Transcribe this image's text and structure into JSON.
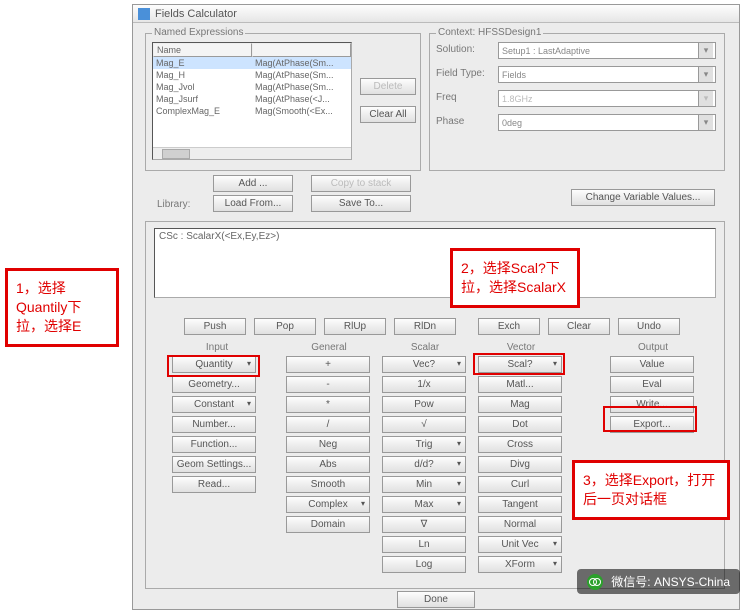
{
  "window": {
    "title": "Fields Calculator"
  },
  "named_expressions": {
    "label": "Named Expressions",
    "headers": [
      "Name",
      ""
    ],
    "rows": [
      {
        "name": "Mag_E",
        "expr": "Mag(AtPhase(Sm..."
      },
      {
        "name": "Mag_H",
        "expr": "Mag(AtPhase(Sm..."
      },
      {
        "name": "Mag_Jvol",
        "expr": "Mag(AtPhase(Sm..."
      },
      {
        "name": "Mag_Jsurf",
        "expr": "Mag(AtPhase(<J..."
      },
      {
        "name": "ComplexMag_E",
        "expr": "Mag(Smooth(<Ex..."
      }
    ],
    "buttons": {
      "delete": "Delete",
      "clear_all": "Clear All"
    }
  },
  "actions": {
    "add": "Add ...",
    "copy": "Copy to stack",
    "load": "Load From...",
    "save": "Save To...",
    "library_label": "Library:"
  },
  "context": {
    "label": "Context: HFSSDesign1",
    "solution_label": "Solution:",
    "solution_value": "Setup1 : LastAdaptive",
    "field_type_label": "Field Type:",
    "field_type_value": "Fields",
    "freq_label": "Freq",
    "freq_value": "1.8GHz",
    "phase_label": "Phase",
    "phase_value": "0deg",
    "change_vars": "Change Variable Values..."
  },
  "stack": {
    "top": "CSc : ScalarX(<Ex,Ey,Ez>)"
  },
  "stack_buttons": {
    "push": "Push",
    "pop": "Pop",
    "rlup": "RlUp",
    "rldn": "RlDn",
    "exch": "Exch",
    "clear": "Clear",
    "undo": "Undo"
  },
  "columns": {
    "input": "Input",
    "general": "General",
    "scalar": "Scalar",
    "vector": "Vector",
    "output": "Output"
  },
  "input": {
    "quantity": "Quantity",
    "geometry": "Geometry...",
    "constant": "Constant",
    "number": "Number...",
    "function": "Function...",
    "geom_settings": "Geom Settings...",
    "read": "Read..."
  },
  "general": {
    "plus": "+",
    "minus": "-",
    "mult": "*",
    "div": "/",
    "neg": "Neg",
    "abs": "Abs",
    "smooth": "Smooth",
    "complex": "Complex",
    "domain": "Domain"
  },
  "scalar": {
    "vec": "Vec?",
    "inv": "1/x",
    "pow": "Pow",
    "sqrt": "√",
    "trig": "Trig",
    "ddt": "d/d?",
    "min": "Min",
    "max": "Max",
    "grad": "∇",
    "ln": "Ln",
    "log": "Log"
  },
  "vector": {
    "scal": "Scal?",
    "matl": "Matl...",
    "mag": "Mag",
    "dot": "Dot",
    "cross": "Cross",
    "divg": "Divg",
    "curl": "Curl",
    "tangent": "Tangent",
    "normal": "Normal",
    "unitvec": "Unit Vec",
    "xform": "XForm"
  },
  "output": {
    "value": "Value",
    "eval": "Eval",
    "write": "Write...",
    "export": "Export..."
  },
  "done": "Done",
  "callouts": {
    "c1": "1，选择Quantily下拉，选择E",
    "c2": "2，选择Scal?下拉，选择ScalarX",
    "c3": "3，选择Export，打开后一页对话框"
  },
  "watermark": "微信号: ANSYS-China"
}
